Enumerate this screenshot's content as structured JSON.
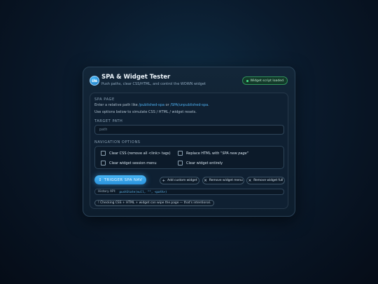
{
  "header": {
    "logo_text": "SPA",
    "title": "SPA & Widget Tester",
    "subtitle": "Push paths, clear CSS/HTML, and control the WOWN widget",
    "status": "Widget script loaded",
    "status_color": "#47e58d"
  },
  "spa_page": {
    "section_label": "SPA PAGE",
    "desc_prefix": "Enter a relative path like ",
    "example_1": "/published-spa",
    "desc_or": " or ",
    "example_2": "/SPA/unpublished-spa",
    "desc_suffix": ".",
    "desc_2": "Use options below to simulate CSS / HTML / widget resets."
  },
  "target_path": {
    "label": "TARGET PATH",
    "value": "",
    "placeholder": "path"
  },
  "nav_options": {
    "label": "NAVIGATION OPTIONS",
    "clear_css": "Clear CSS (remove all <link> tags)",
    "replace_html_prefix": "Replace HTML with ",
    "replace_html_em": "\"SPA new page\"",
    "clear_session_menu": "Clear widget session menu",
    "clear_widget": "Clear widget entirely"
  },
  "actions": {
    "trigger": "TRIGGER SPA NAV",
    "trigger_icon": "↕",
    "add_custom": "Add custom widget",
    "add_icon": "+",
    "remove_menu": "Remove widget menu",
    "remove_full": "Remove widget full",
    "close_icon": "✕"
  },
  "history_api": {
    "label": "History API:",
    "code": "pushState(null, \"\", <path>)"
  },
  "warning": "! Checking CSS + HTML + widget can wipe the page — that's intentional.",
  "colors": {
    "accent": "#3fa8ef",
    "link": "#4fb1f2",
    "background": "#0a1a2c"
  }
}
